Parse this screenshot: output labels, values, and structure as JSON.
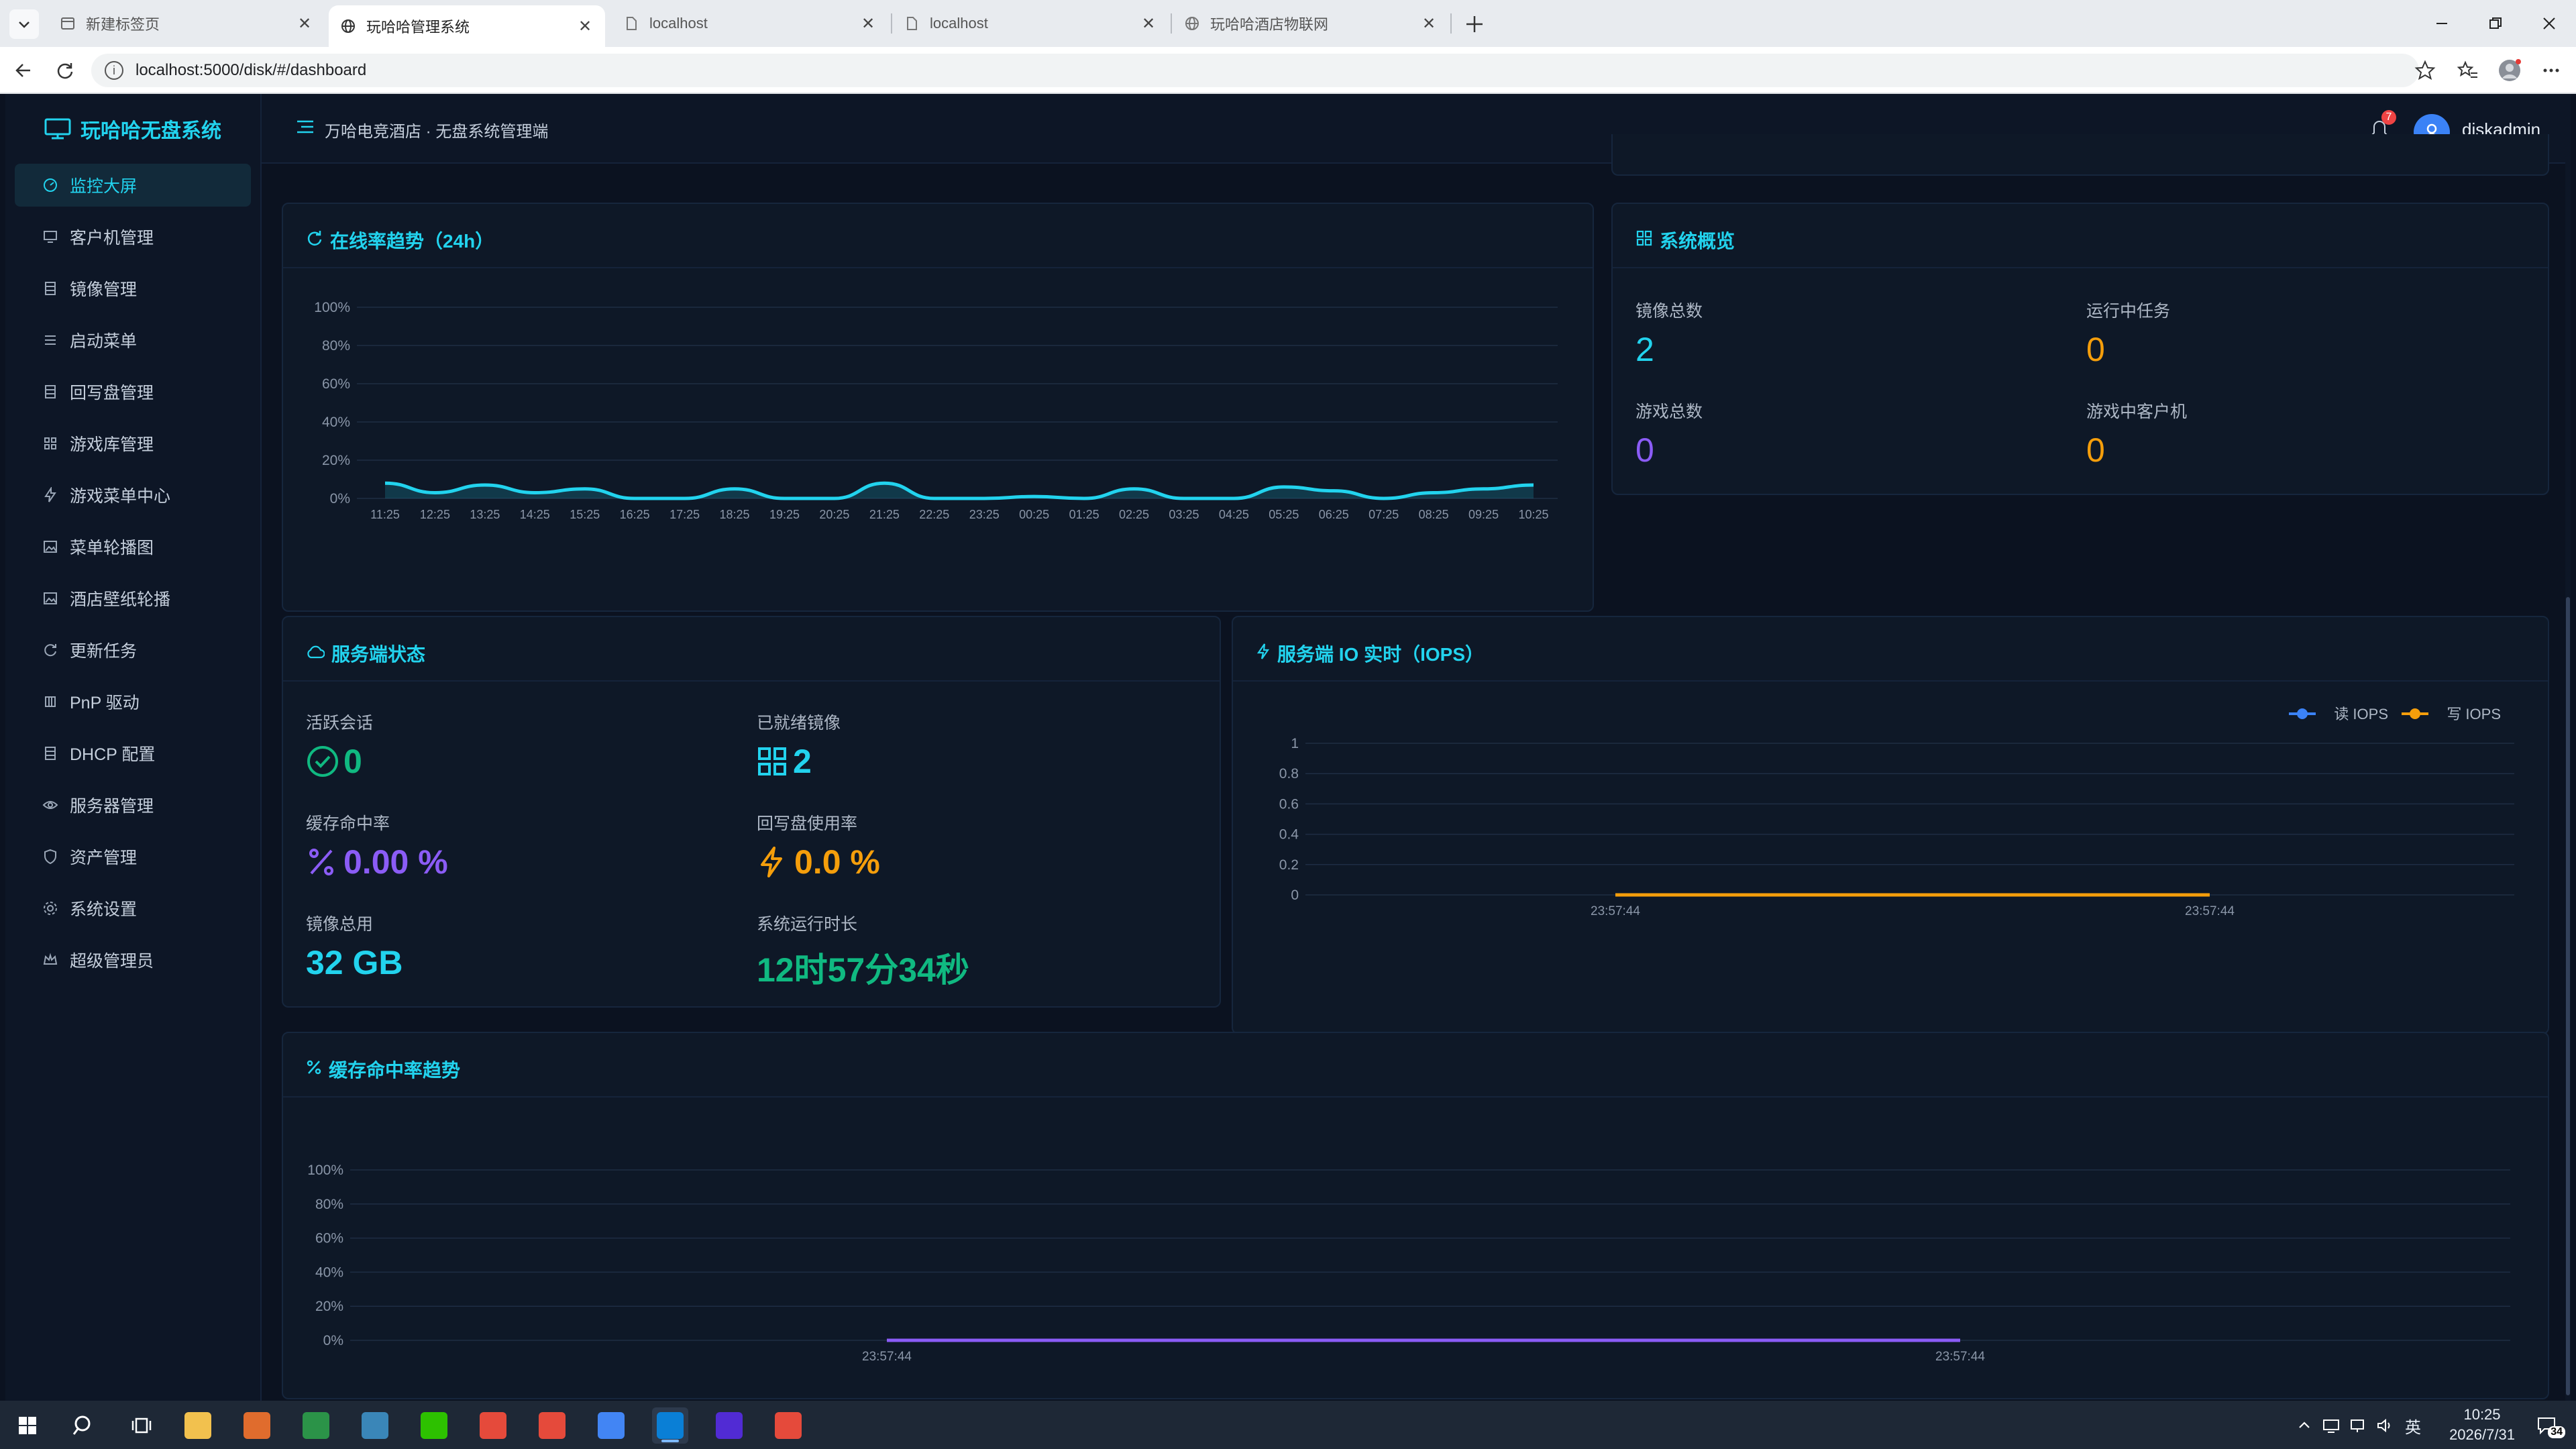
{
  "browser": {
    "tabs": [
      {
        "title": "新建标签页",
        "active": false
      },
      {
        "title": "玩哈哈管理系统",
        "active": true
      },
      {
        "title": "localhost",
        "active": false
      },
      {
        "title": "localhost",
        "active": false
      },
      {
        "title": "玩哈哈酒店物联网",
        "active": false
      }
    ],
    "url": "localhost:5000/disk/#/dashboard"
  },
  "app": {
    "brand": "玩哈哈无盘系统",
    "header_title": "万哈电竞酒店 · 无盘系统管理端",
    "notification_count": "7",
    "username": "diskadmin"
  },
  "sidebar": {
    "items": [
      {
        "label": "监控大屏",
        "icon": "dashboard-icon",
        "active": true
      },
      {
        "label": "客户机管理",
        "icon": "monitor-icon",
        "active": false
      },
      {
        "label": "镜像管理",
        "icon": "disk-icon",
        "active": false
      },
      {
        "label": "启动菜单",
        "icon": "list-icon",
        "active": false
      },
      {
        "label": "回写盘管理",
        "icon": "disk-icon",
        "active": false
      },
      {
        "label": "游戏库管理",
        "icon": "grid-icon",
        "active": false
      },
      {
        "label": "游戏菜单中心",
        "icon": "bolt-icon",
        "active": false
      },
      {
        "label": "菜单轮播图",
        "icon": "image-icon",
        "active": false
      },
      {
        "label": "酒店壁纸轮播",
        "icon": "image-icon",
        "active": false
      },
      {
        "label": "更新任务",
        "icon": "refresh-icon",
        "active": false
      },
      {
        "label": "PnP 驱动",
        "icon": "chip-icon",
        "active": false
      },
      {
        "label": "DHCP 配置",
        "icon": "disk-icon",
        "active": false
      },
      {
        "label": "服务器管理",
        "icon": "eye-icon",
        "active": false
      },
      {
        "label": "资产管理",
        "icon": "shield-icon",
        "active": false
      },
      {
        "label": "系统设置",
        "icon": "gear-icon",
        "active": false
      },
      {
        "label": "超级管理员",
        "icon": "crown-icon",
        "active": false
      }
    ]
  },
  "online_card": {
    "title": "在线率趋势（24h）"
  },
  "overview_card": {
    "title": "系统概览",
    "stats": [
      {
        "label": "镜像总数",
        "value": "2",
        "color": "#22d3ee"
      },
      {
        "label": "运行中任务",
        "value": "0",
        "color": "#f59e0b"
      },
      {
        "label": "游戏总数",
        "value": "0",
        "color": "#8b5cf6"
      },
      {
        "label": "游戏中客户机",
        "value": "0",
        "color": "#f59e0b"
      }
    ]
  },
  "server_card": {
    "title": "服务端状态",
    "stats": [
      {
        "label": "活跃会话",
        "value": "0",
        "color": "#10b981",
        "icon": "check-circle-icon"
      },
      {
        "label": "已就绪镜像",
        "value": "2",
        "color": "#22d3ee",
        "icon": "grid-icon"
      },
      {
        "label": "缓存命中率",
        "value": "0.00 %",
        "color": "#8b5cf6",
        "icon": "percent-icon"
      },
      {
        "label": "回写盘使用率",
        "value": "0.0 %",
        "color": "#f59e0b",
        "icon": "bolt-icon"
      },
      {
        "label": "镜像总用",
        "value": "32 GB",
        "color": "#22d3ee",
        "icon": ""
      },
      {
        "label": "系统运行时长",
        "value": "12时57分34秒",
        "color": "#10b981",
        "icon": ""
      }
    ]
  },
  "iops_card": {
    "title": "服务端 IO 实时（IOPS）"
  },
  "cache_card": {
    "title": "缓存命中率趋势"
  },
  "chart_data": [
    {
      "type": "area",
      "title": "在线率趋势（24h）",
      "x": [
        "11:25",
        "12:25",
        "13:25",
        "14:25",
        "15:25",
        "16:25",
        "17:25",
        "18:25",
        "19:25",
        "20:25",
        "21:25",
        "22:25",
        "23:25",
        "00:25",
        "01:25",
        "02:25",
        "03:25",
        "04:25",
        "05:25",
        "06:25",
        "07:25",
        "08:25",
        "09:25",
        "10:25"
      ],
      "series": [
        {
          "values": [
            8,
            3,
            7,
            3,
            5,
            0,
            0,
            5,
            0,
            0,
            8,
            0,
            0,
            1,
            0,
            5,
            0,
            0,
            6,
            4,
            0,
            3,
            5,
            7
          ],
          "color": "#22d3ee"
        }
      ],
      "yticks": [
        "0%",
        "20%",
        "40%",
        "60%",
        "80%",
        "100%"
      ],
      "ylim": [
        0,
        100
      ],
      "grid": true
    },
    {
      "type": "line",
      "title": "服务端 IO 实时（IOPS）",
      "x": [
        "23:57:44",
        "23:57:44"
      ],
      "series": [
        {
          "name": "读 IOPS",
          "values": [
            0,
            0
          ],
          "color": "#3b82f6"
        },
        {
          "name": "写 IOPS",
          "values": [
            0,
            0
          ],
          "color": "#f59e0b"
        }
      ],
      "yticks": [
        "0",
        "0.2",
        "0.4",
        "0.6",
        "0.8",
        "1"
      ],
      "ylim": [
        0,
        1
      ],
      "legend": "top-right",
      "grid": true
    },
    {
      "type": "line",
      "title": "缓存命中率趋势",
      "x": [
        "23:57:44",
        "23:57:44"
      ],
      "series": [
        {
          "values": [
            0,
            0
          ],
          "color": "#8b5cf6"
        }
      ],
      "yticks": [
        "0%",
        "20%",
        "40%",
        "60%",
        "80%",
        "100%"
      ],
      "ylim": [
        0,
        100
      ],
      "grid": true
    }
  ],
  "taskbar": {
    "time": "10:25",
    "date": "2026/7/31",
    "ime": "英",
    "notifications": "34",
    "apps": [
      {
        "name": "file-explorer",
        "color": "#f2c14e",
        "active": false
      },
      {
        "name": "app-c",
        "color": "#e06c2d",
        "active": false
      },
      {
        "name": "terminal",
        "color": "#2b9348",
        "active": false
      },
      {
        "name": "notepad",
        "color": "#3a86b8",
        "active": false
      },
      {
        "name": "wechat",
        "color": "#2dc100",
        "active": false
      },
      {
        "name": "wps-writer",
        "color": "#e54a3b",
        "active": false
      },
      {
        "name": "wps-writer-2",
        "color": "#e54a3b",
        "active": false
      },
      {
        "name": "chrome",
        "color": "#4285f4",
        "active": false
      },
      {
        "name": "edge",
        "color": "#0a7fd6",
        "active": true
      },
      {
        "name": "dotnet",
        "color": "#512bd4",
        "active": false
      },
      {
        "name": "wps",
        "color": "#e54a3b",
        "active": false
      }
    ]
  }
}
